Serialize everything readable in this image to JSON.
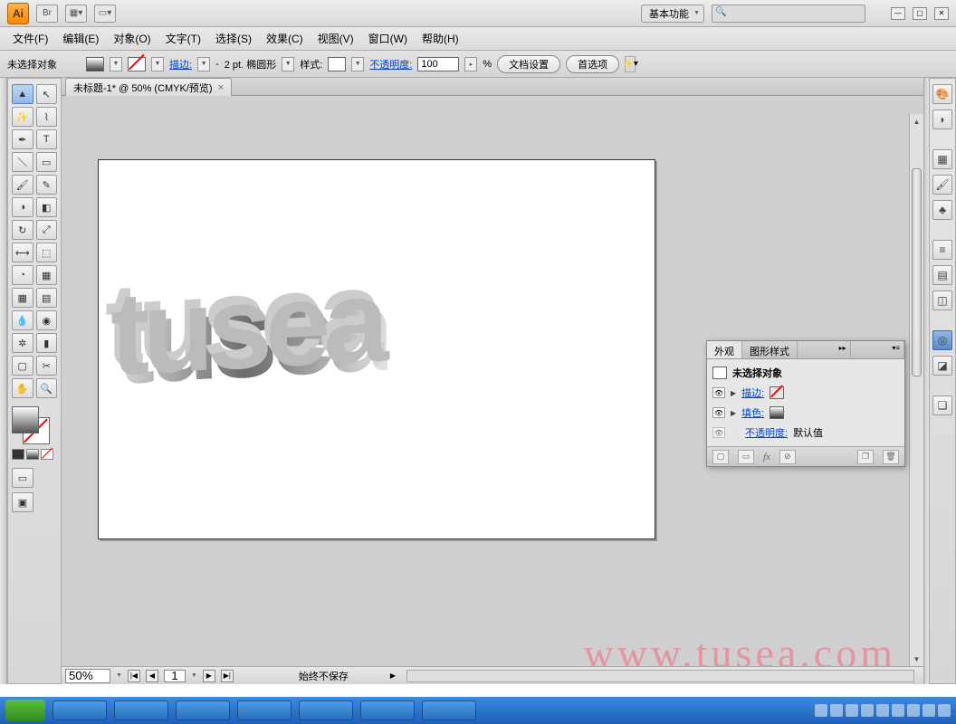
{
  "titlebar": {
    "logo": "Ai",
    "br_label": "Br",
    "workspace": "基本功能"
  },
  "menubar": {
    "file": "文件(F)",
    "edit": "编辑(E)",
    "object": "对象(O)",
    "type": "文字(T)",
    "select": "选择(S)",
    "effect": "效果(C)",
    "view": "视图(V)",
    "window": "窗口(W)",
    "help": "帮助(H)"
  },
  "optbar": {
    "no_selection": "未选择对象",
    "stroke_label": "描边:",
    "stroke_pt": "2 pt. 椭圆形",
    "style_label": "样式:",
    "opacity_label": "不透明度:",
    "opacity_value": "100",
    "percent": "%",
    "doc_setup": "文档设置",
    "prefs": "首选项",
    "dash": "-"
  },
  "doctab": {
    "title": "未标题-1* @ 50% (CMYK/预览)"
  },
  "canvas": {
    "art_text": "tusea",
    "watermark": "www.tusea.com"
  },
  "status": {
    "zoom": "50%",
    "page": "1",
    "autosave": "始终不保存"
  },
  "panel": {
    "tab_appearance": "外观",
    "tab_graphic_styles": "图形样式",
    "title": "未选择对象",
    "stroke": "描边:",
    "fill": "填色:",
    "opacity": "不透明度:",
    "opacity_val": "默认值",
    "fx": "fx"
  }
}
